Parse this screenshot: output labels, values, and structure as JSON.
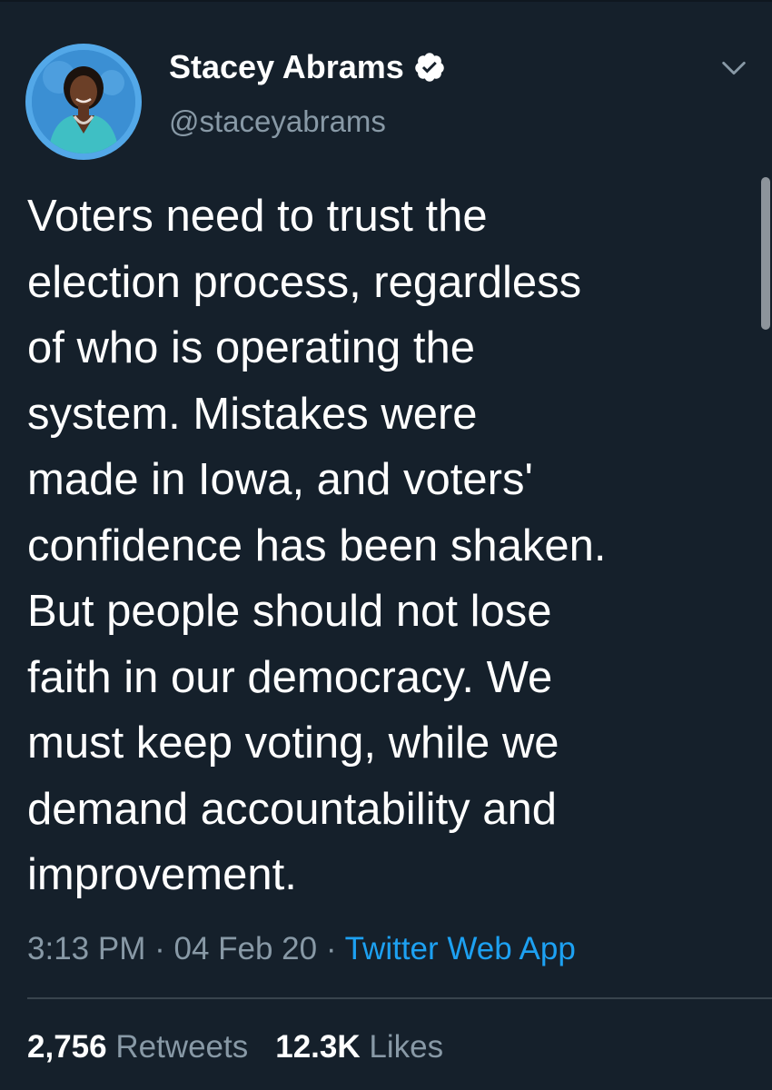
{
  "author": {
    "display_name": "Stacey Abrams",
    "handle": "@staceyabrams",
    "verified_icon": "verified-badge-icon"
  },
  "tweet": {
    "lines": [
      "Voters need to trust the",
      "election process, regardless",
      "of who is operating the",
      "system. Mistakes were",
      "made in Iowa, and voters'",
      "confidence has been shaken.",
      "But people should not lose",
      "faith in our democracy. We",
      "must keep voting, while we",
      "demand accountability and",
      "improvement."
    ]
  },
  "meta": {
    "time": "3:13 PM",
    "separator": "·",
    "date": "04 Feb 20",
    "source": "Twitter Web App"
  },
  "stats": {
    "retweets_count": "2,756",
    "retweets_label": "Retweets",
    "likes_count": "12.3K",
    "likes_label": "Likes"
  },
  "colors": {
    "background": "#15202b",
    "text": "#ffffff",
    "secondary_text": "#8899a6",
    "link": "#1da1f2",
    "divider": "#38444d"
  }
}
